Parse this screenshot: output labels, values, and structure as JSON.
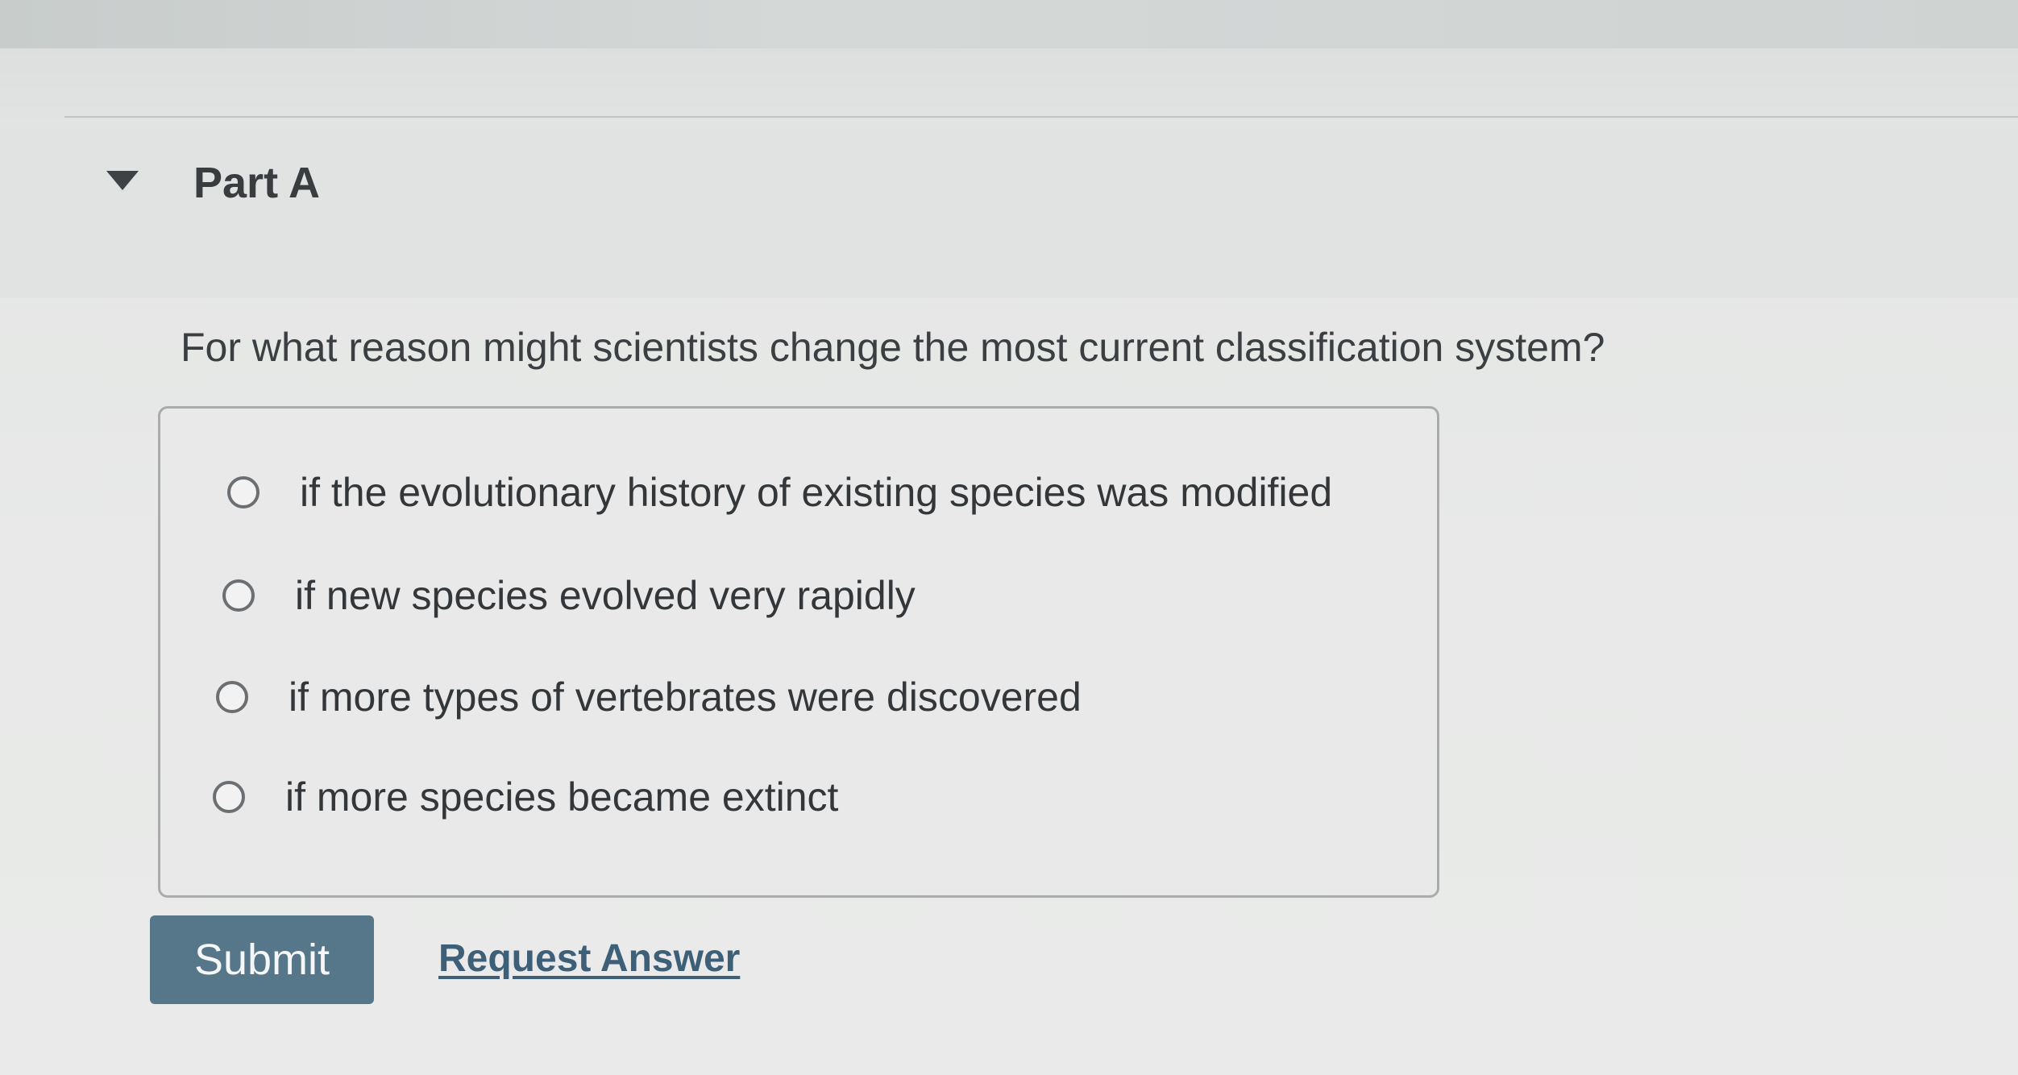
{
  "part": {
    "title": "Part A",
    "expanded_icon": "caret-down-icon"
  },
  "question": {
    "text": "For what reason might scientists change the most current classification system?"
  },
  "options": [
    {
      "label": "if the evolutionary history of existing species was modified",
      "selected": false
    },
    {
      "label": "if new species evolved very rapidly",
      "selected": false
    },
    {
      "label": "if more types of vertebrates were discovered",
      "selected": false
    },
    {
      "label": "if more species became extinct",
      "selected": false
    }
  ],
  "actions": {
    "submit_label": "Submit",
    "request_answer_label": "Request Answer"
  },
  "colors": {
    "submit_background": "#56768a",
    "link": "#3d5f78"
  }
}
